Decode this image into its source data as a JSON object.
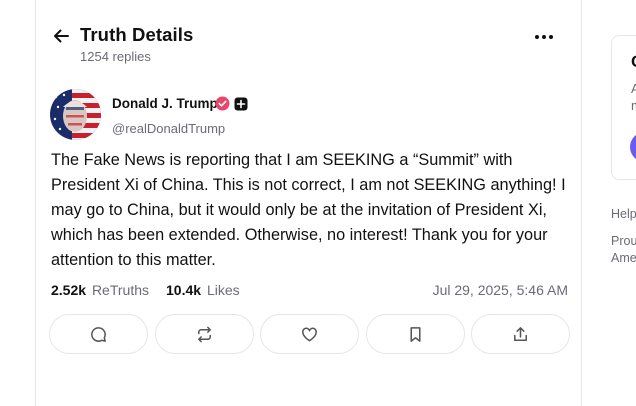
{
  "header": {
    "title": "Truth Details",
    "replies": "1254 replies"
  },
  "post": {
    "author_name": "Donald J. Trump",
    "author_handle": "@realDonaldTrump",
    "text": "The Fake News is reporting that I am SEEKING a “Summit” with President Xi of China. This is not correct, I am not SEEKING anything! I may go to China, but it would only be at the invitation of President Xi, which has been extended. Otherwise, no interest! Thank you for your attention to this matter.",
    "retruths_count": "2.52k",
    "retruths_label": "ReTruths",
    "likes_count": "10.4k",
    "likes_label": "Likes",
    "timestamp": "Jul 29, 2025, 5:46 AM"
  },
  "actions": [
    "reply-icon",
    "retruth-icon",
    "like-icon",
    "bookmark-icon",
    "share-icon"
  ],
  "right_panel": {
    "card_title_fragment": "C",
    "card_line1_fragment": "A",
    "card_line2_fragment": "m",
    "help_fragment": "Help",
    "proud_fragment": "Prou",
    "america_fragment": "Ame"
  },
  "colors": {
    "verified": "#e8476a",
    "accent": "#6a5cf0",
    "muted_text": "#6b6b76",
    "border": "#e6e6ea"
  }
}
